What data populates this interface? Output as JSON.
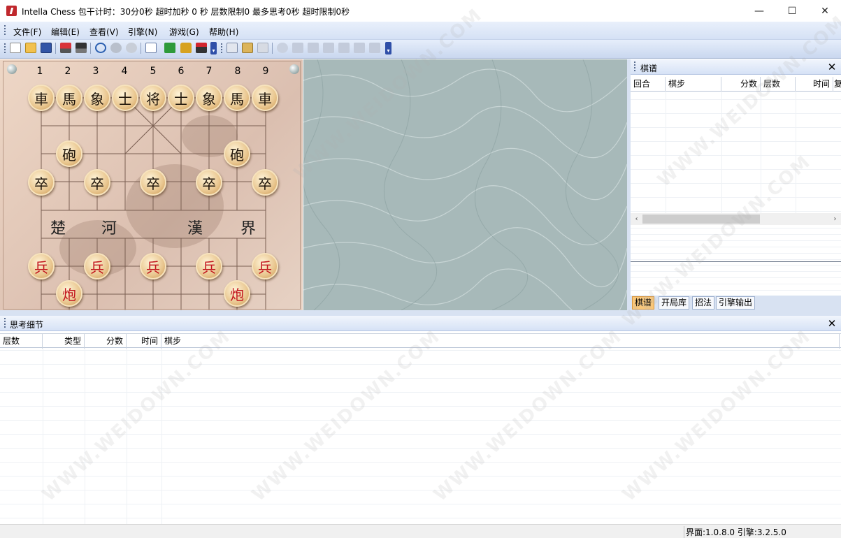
{
  "window": {
    "title": "Intella Chess 包干计时：30分0秒 超时加秒 0 秒 层数限制0 最多思考0秒 超时限制0秒",
    "minimize": "—",
    "maximize": "☐",
    "close": "✕"
  },
  "menu": [
    "文件(F)",
    "编辑(E)",
    "查看(V)",
    "引擎(N)",
    "游戏(G)",
    "帮助(H)"
  ],
  "board": {
    "columns": [
      "1",
      "2",
      "3",
      "4",
      "5",
      "6",
      "7",
      "8",
      "9"
    ],
    "river": [
      "楚",
      "河",
      "漢",
      "界"
    ],
    "back_rank": [
      "車",
      "馬",
      "象",
      "士",
      "将",
      "士",
      "象",
      "馬",
      "車"
    ],
    "black_cannon": "砲",
    "black_pawn": "卒",
    "red_pawn": "兵",
    "red_cannon": "炮"
  },
  "notation_panel": {
    "title": "棋谱",
    "columns": [
      "回合",
      "棋步",
      "分数",
      "层数",
      "时间",
      "复"
    ],
    "tabs": [
      "棋谱",
      "开局库",
      "招法",
      "引擎输出"
    ],
    "active_tab": 0,
    "scroll_left": "‹",
    "scroll_right": "›"
  },
  "thinking_panel": {
    "title": "思考细节",
    "columns": [
      "层数",
      "类型",
      "分数",
      "时间",
      "棋步"
    ]
  },
  "status": {
    "text": "界面:1.0.8.0 引擎:3.2.5.0"
  },
  "watermark": "WWW.WEIDOWN.COM",
  "colors": {
    "menu_bg": "#d5e1f5",
    "board_bg": "#e6cfc0",
    "texture_bg": "#a7b9b9",
    "piece_red": "#c1121b",
    "piece_black": "#1c1208",
    "active_tab": "#f9c77a"
  }
}
